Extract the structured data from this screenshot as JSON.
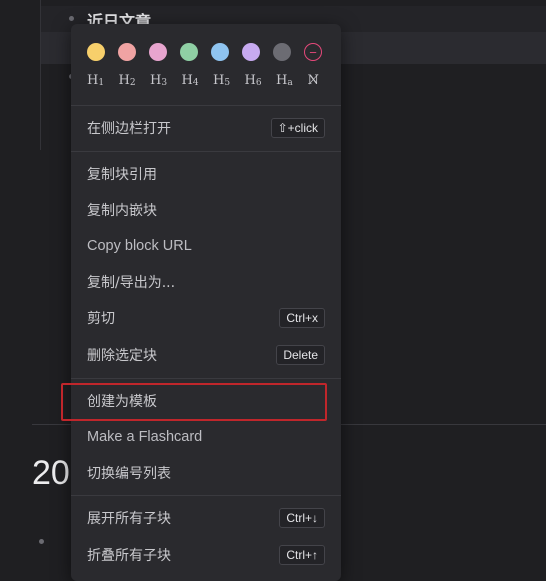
{
  "background": {
    "block_title": "近日文章",
    "year_heading": "20"
  },
  "colors": {
    "swatches": [
      "#f7cf6b",
      "#f0a3a3",
      "#e8a5cf",
      "#8fcfa4",
      "#8fc4f0",
      "#c7aaf0",
      "#6c6c73"
    ],
    "clear_swatch": "#e5487a",
    "highlight_border": "#c0262b"
  },
  "menu": {
    "clear_color_symbol": "−",
    "headings": [
      {
        "label": "H",
        "sub": "1"
      },
      {
        "label": "H",
        "sub": "2"
      },
      {
        "label": "H",
        "sub": "3"
      },
      {
        "label": "H",
        "sub": "4"
      },
      {
        "label": "H",
        "sub": "5"
      },
      {
        "label": "H",
        "sub": "6"
      },
      {
        "label": "H",
        "sub": "a"
      }
    ],
    "clear_heading_symbol": "N̸",
    "open_sidebar": {
      "label": "在侧边栏打开",
      "shortcut": "⇧+click"
    },
    "copy_block_ref": {
      "label": "复制块引用"
    },
    "copy_embed": {
      "label": "复制内嵌块"
    },
    "copy_url": {
      "label": "Copy block URL"
    },
    "copy_export": {
      "label": "复制/导出为..."
    },
    "cut": {
      "label": "剪切",
      "shortcut": "Ctrl+x"
    },
    "delete": {
      "label": "删除选定块",
      "shortcut": "Delete"
    },
    "make_template": {
      "label": "创建为模板"
    },
    "make_flashcard": {
      "label": "Make a Flashcard"
    },
    "toggle_numbered": {
      "label": "切换编号列表"
    },
    "expand_all": {
      "label": "展开所有子块",
      "shortcut": "Ctrl+↓"
    },
    "collapse_all": {
      "label": "折叠所有子块",
      "shortcut": "Ctrl+↑"
    }
  }
}
